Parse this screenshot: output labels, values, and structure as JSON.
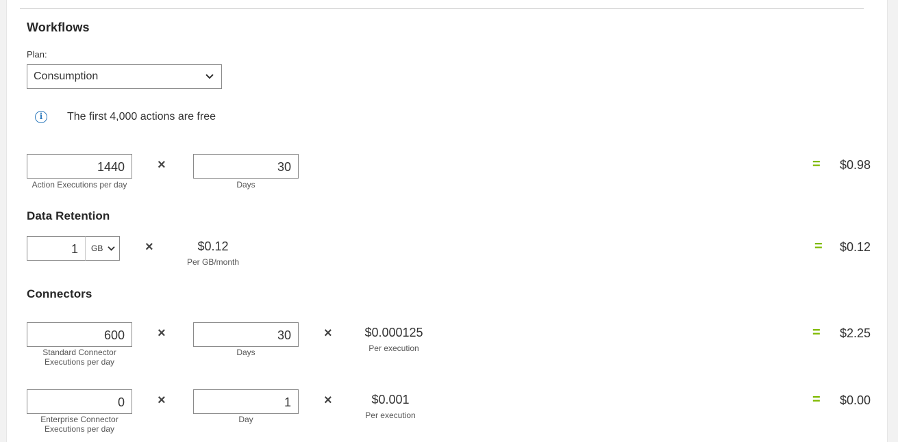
{
  "workflows": {
    "title": "Workflows",
    "plan_label": "Plan:",
    "plan_value": "Consumption",
    "info_text": "The first 4,000 actions are free",
    "action_executions": "1440",
    "action_executions_caption": "Action Executions per day",
    "days": "30",
    "days_caption": "Days",
    "total": "$0.98"
  },
  "retention": {
    "title": "Data Retention",
    "amount": "1",
    "unit": "GB",
    "price": "$0.12",
    "price_caption": "Per GB/month",
    "total": "$0.12"
  },
  "connectors": {
    "title": "Connectors",
    "standard": {
      "executions": "600",
      "caption_line1": "Standard Connector",
      "caption_line2": "Executions per day",
      "days": "30",
      "days_caption": "Days",
      "price": "$0.000125",
      "price_caption": "Per execution",
      "total": "$2.25"
    },
    "enterprise": {
      "executions": "0",
      "caption_line1": "Enterprise Connector",
      "caption_line2": "Executions per day",
      "days": "1",
      "days_caption": "Day",
      "price": "$0.001",
      "price_caption": "Per execution",
      "total": "$0.00"
    }
  },
  "symbols": {
    "times": "×",
    "equals": "="
  },
  "colors": {
    "accent_green": "#7fba00",
    "info_blue": "#2f7bbd"
  },
  "icons": {
    "dropdown": "chevron-down-icon",
    "info": "info-icon"
  }
}
